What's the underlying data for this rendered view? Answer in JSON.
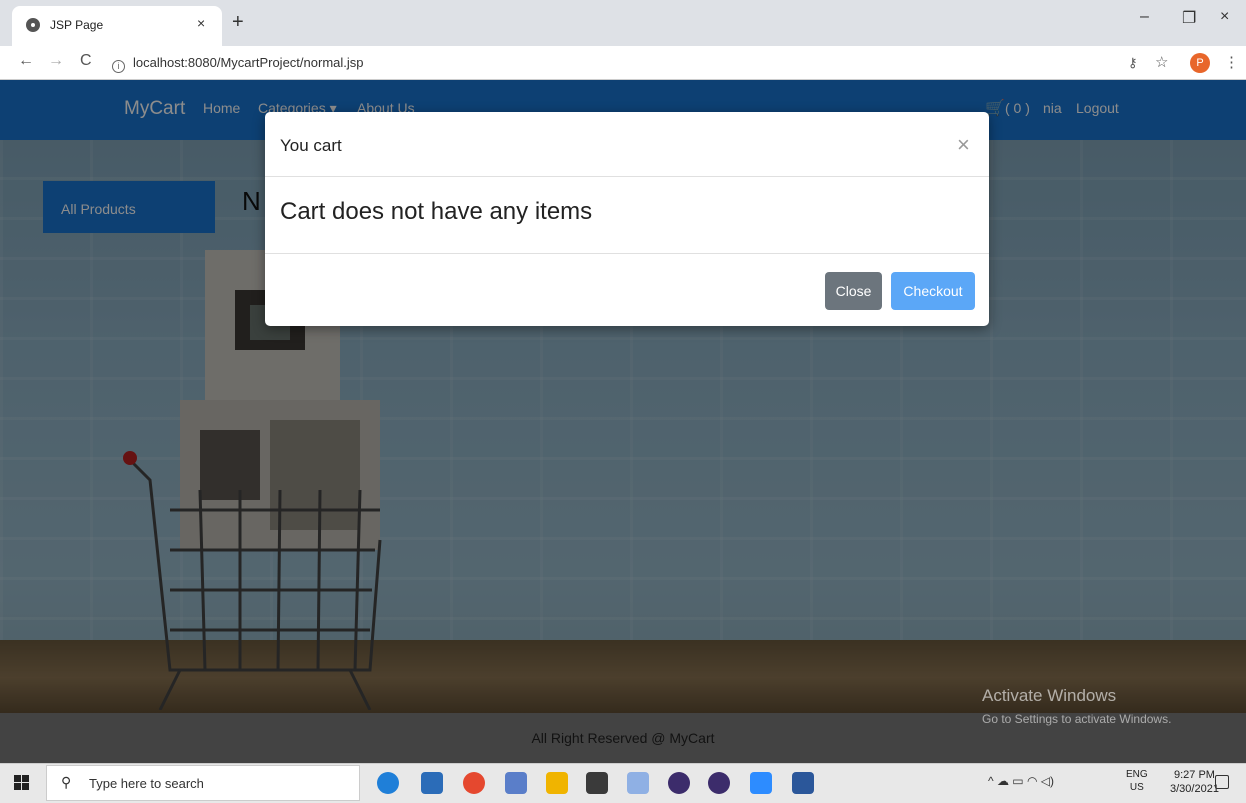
{
  "browser": {
    "tab_title": "JSP Page",
    "tab_close": "×",
    "new_tab": "+",
    "url": "localhost:8080/MycartProject/normal.jsp",
    "profile_initial": "P",
    "window_controls": {
      "minimize": "–",
      "restore": "❐",
      "close": "×"
    }
  },
  "navbar": {
    "brand": "MyCart",
    "home": "Home",
    "categories": "Categories ▾",
    "about": "About Us",
    "cart_label": "( 0 )",
    "user": "nia",
    "logout": "Logout",
    "color": "#1976d2"
  },
  "sidebar": {
    "all_products": "All Products"
  },
  "main": {
    "heading_partial": "N"
  },
  "modal": {
    "title": "You cart",
    "close_x": "×",
    "message": "Cart does not have any items",
    "close_button": "Close",
    "checkout_button": "Checkout",
    "checkout_color": "#5ba7f7",
    "close_color": "#6c757d"
  },
  "footer": {
    "text": "All Right Reserved @ MyCart"
  },
  "watermark": {
    "line1": "Activate Windows",
    "line2": "Go to Settings to activate Windows."
  },
  "taskbar": {
    "search_placeholder": "Type here to search",
    "language": "ENG",
    "region": "US",
    "time": "9:27 PM",
    "date": "3/30/2021"
  }
}
